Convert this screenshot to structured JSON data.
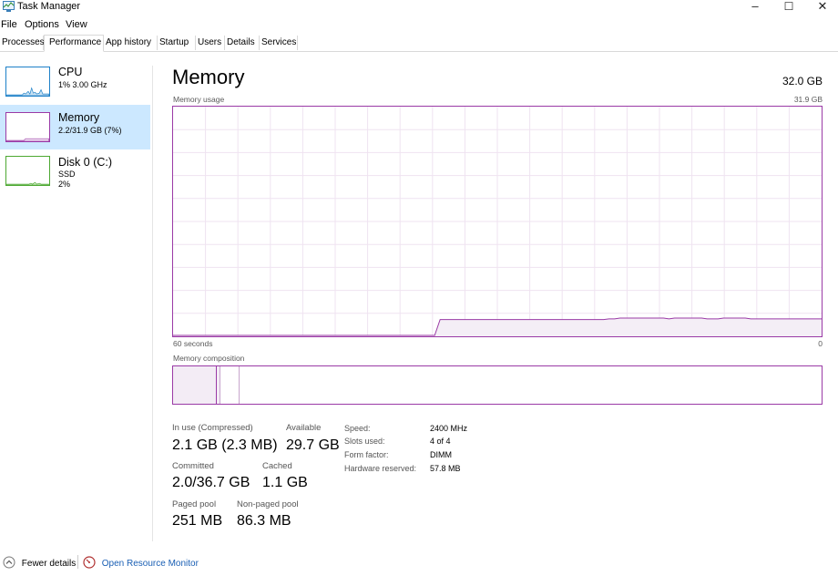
{
  "window": {
    "title": "Task Manager",
    "minimize_glyph": "–",
    "maximize_glyph": "☐",
    "close_glyph": "✕"
  },
  "menu": [
    "File",
    "Options",
    "View"
  ],
  "tabs": [
    {
      "label": "Processes",
      "active": false
    },
    {
      "label": "Performance",
      "active": true
    },
    {
      "label": "App history",
      "active": false
    },
    {
      "label": "Startup",
      "active": false
    },
    {
      "label": "Users",
      "active": false
    },
    {
      "label": "Details",
      "active": false
    },
    {
      "label": "Services",
      "active": false
    }
  ],
  "sidebar": {
    "items": [
      {
        "name": "CPU",
        "sub1": "1% 3.00 GHz",
        "sub2": "",
        "sub3": "",
        "color": "#1d80c8",
        "selected": false
      },
      {
        "name": "Memory",
        "sub1": "2.2/31.9 GB (7%)",
        "sub2": "",
        "sub3": "",
        "color": "#9a3aa6",
        "selected": true
      },
      {
        "name": "Disk 0 (C:)",
        "sub1": "SSD",
        "sub2": "2%",
        "sub3": "",
        "color": "#4da832",
        "selected": false
      }
    ]
  },
  "main": {
    "title": "Memory",
    "total": "32.0 GB",
    "graph": {
      "label": "Memory usage",
      "max_label": "31.9 GB",
      "x_left_label": "60 seconds",
      "x_right_label": "0",
      "color": "#9a3aa6",
      "usage_series_gb": [
        0,
        0,
        0,
        0,
        0,
        0,
        0,
        0,
        0,
        0,
        0,
        0,
        0,
        0,
        0,
        0,
        0,
        0,
        0,
        0,
        0,
        0,
        0,
        0,
        0,
        0,
        0,
        0,
        0,
        0,
        0,
        0,
        0,
        0,
        0,
        0,
        0,
        0,
        0,
        0,
        0,
        0,
        0,
        0,
        0,
        0,
        0,
        0,
        0,
        2.2,
        2.2,
        2.2,
        2.2,
        2.2,
        2.2,
        2.2,
        2.2,
        2.2,
        2.2,
        2.2,
        2.2,
        2.2,
        2.2,
        2.2,
        2.2,
        2.2,
        2.2,
        2.2,
        2.2,
        2.2,
        2.2,
        2.2,
        2.2,
        2.2,
        2.2,
        2.2,
        2.2,
        2.2,
        2.2,
        2.2,
        2.3,
        2.3,
        2.4,
        2.4,
        2.4,
        2.4,
        2.4,
        2.4,
        2.4,
        2.4,
        2.4,
        2.3,
        2.4,
        2.4,
        2.4,
        2.4,
        2.4,
        2.4,
        2.3,
        2.3,
        2.3,
        2.4,
        2.4,
        2.4,
        2.4,
        2.4,
        2.3,
        2.3,
        2.3,
        2.3,
        2.3,
        2.3,
        2.3,
        2.3,
        2.3,
        2.3,
        2.3,
        2.3,
        2.3,
        2.3
      ],
      "y_max_gb": 31.9
    },
    "composition": {
      "label": "Memory composition",
      "in_use_fraction": 0.068,
      "modified_fraction": 0.006,
      "standby_fraction": 0.029
    },
    "stats": {
      "in_use_label": "In use (Compressed)",
      "in_use_value": "2.1 GB (2.3 MB)",
      "available_label": "Available",
      "available_value": "29.7 GB",
      "committed_label": "Committed",
      "committed_value": "2.0/36.7 GB",
      "cached_label": "Cached",
      "cached_value": "1.1 GB",
      "paged_label": "Paged pool",
      "paged_value": "251 MB",
      "nonpaged_label": "Non-paged pool",
      "nonpaged_value": "86.3 MB"
    },
    "details": [
      {
        "label": "Speed:",
        "value": "2400 MHz"
      },
      {
        "label": "Slots used:",
        "value": "4 of 4"
      },
      {
        "label": "Form factor:",
        "value": "DIMM"
      },
      {
        "label": "Hardware reserved:",
        "value": "57.8 MB"
      }
    ]
  },
  "footer": {
    "fewer_details": "Fewer details",
    "resource_monitor": "Open Resource Monitor",
    "link_color": "#1a5fb4"
  }
}
